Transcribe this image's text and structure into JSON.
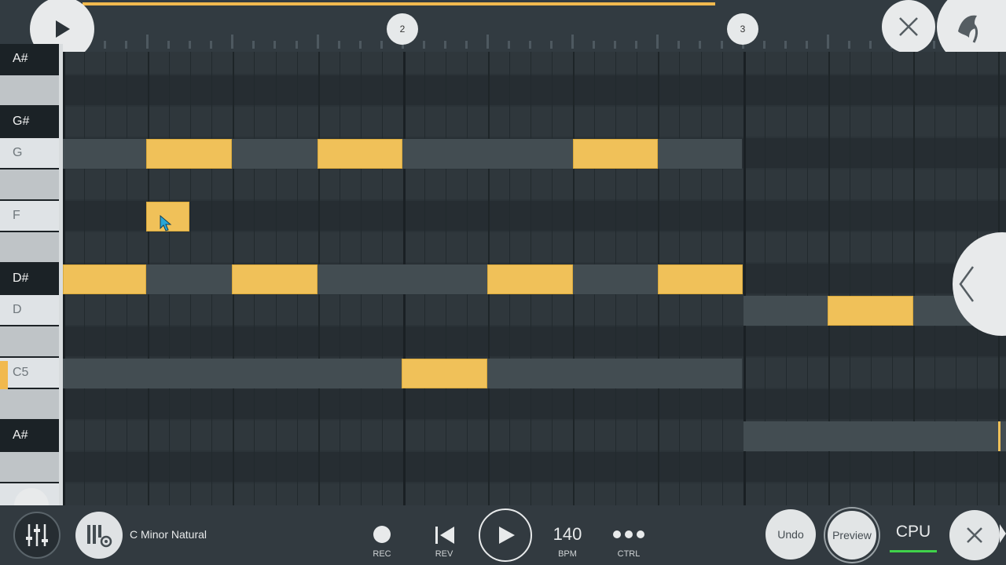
{
  "timeline": {
    "bar_markers": [
      "2",
      "3"
    ],
    "progress_color": "#f1b94e"
  },
  "keyboard": {
    "keys": [
      "A#",
      "G#",
      "G",
      "F",
      "D#",
      "D",
      "C5",
      "A#"
    ]
  },
  "scale": {
    "name": "C Minor Natural"
  },
  "transport": {
    "rec_label": "REC",
    "rev_label": "REV",
    "bpm_value": "140",
    "bpm_label": "BPM",
    "ctrl_label": "CTRL"
  },
  "actions": {
    "undo_label": "Undo",
    "preview_label": "Preview",
    "cpu_label": "CPU"
  },
  "colors": {
    "note": "#f0c159",
    "cpu_meter": "#3fd24a"
  },
  "icons": [
    "play-icon",
    "close-icon",
    "fl-logo-icon",
    "chevron-left-icon",
    "mixer-icon",
    "piano-settings-icon",
    "record-icon",
    "skip-back-icon",
    "more-icon"
  ]
}
